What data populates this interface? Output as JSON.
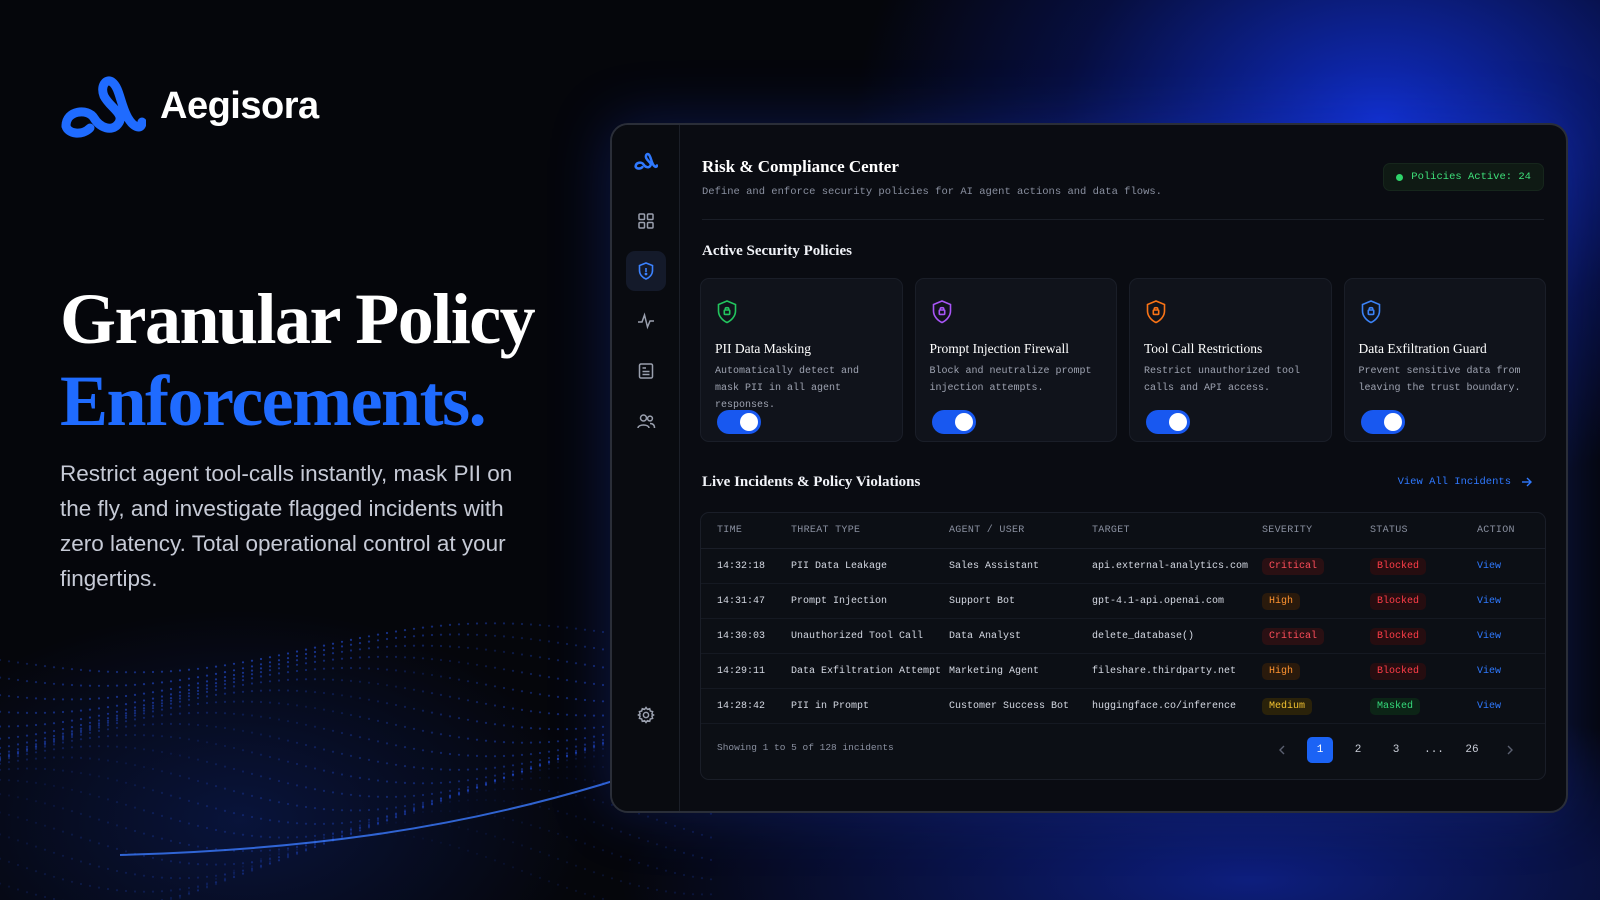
{
  "brand": {
    "name": "Aegisora"
  },
  "hero": {
    "line1": "Granular Policy",
    "line2": "Enforcements.",
    "description": "Restrict agent tool-calls instantly, mask PII on the fly, and investigate flagged incidents with zero latency. Total operational control at your fingertips."
  },
  "sidebar": {
    "items": [
      {
        "icon": "logo-icon"
      },
      {
        "icon": "dashboard-grid-icon"
      },
      {
        "icon": "shield-icon",
        "active": true
      },
      {
        "icon": "activity-icon"
      },
      {
        "icon": "report-icon"
      },
      {
        "icon": "users-icon"
      },
      {
        "icon": "gear-icon"
      }
    ]
  },
  "header": {
    "title": "Risk & Compliance Center",
    "subtitle": "Define and enforce security policies for AI agent actions and data flows.",
    "status": "Policies Active: 24"
  },
  "policies": {
    "section_title": "Active Security Policies",
    "cards": [
      {
        "title": "PII Data Masking",
        "description": "Automatically detect and mask PII in all agent responses.",
        "icon_color": "#22c55e",
        "enabled": true
      },
      {
        "title": "Prompt Injection Firewall",
        "description": "Block and neutralize prompt injection attempts.",
        "icon_color": "#a855f7",
        "enabled": true
      },
      {
        "title": "Tool Call Restrictions",
        "description": "Restrict unauthorized tool calls and API access.",
        "icon_color": "#f97316",
        "enabled": true
      },
      {
        "title": "Data Exfiltration Guard",
        "description": "Prevent sensitive data from leaving the trust boundary.",
        "icon_color": "#3b82f6",
        "enabled": true
      }
    ]
  },
  "incidents": {
    "section_title": "Live Incidents & Policy Violations",
    "view_all": "View All Incidents",
    "columns": [
      "TIME",
      "THREAT TYPE",
      "AGENT / USER",
      "TARGET",
      "SEVERITY",
      "STATUS",
      "ACTION"
    ],
    "rows": [
      {
        "time": "14:32:18",
        "threat": "PII Data Leakage",
        "agent": "Sales Assistant",
        "target": "api.external-analytics.com",
        "severity": "Critical",
        "status": "Blocked",
        "action": "View"
      },
      {
        "time": "14:31:47",
        "threat": "Prompt Injection",
        "agent": "Support Bot",
        "target": "gpt-4.1-api.openai.com",
        "severity": "High",
        "status": "Blocked",
        "action": "View"
      },
      {
        "time": "14:30:03",
        "threat": "Unauthorized Tool Call",
        "agent": "Data Analyst",
        "target": "delete_database()",
        "severity": "Critical",
        "status": "Blocked",
        "action": "View"
      },
      {
        "time": "14:29:11",
        "threat": "Data Exfiltration Attempt",
        "agent": "Marketing Agent",
        "target": "fileshare.thirdparty.net",
        "severity": "High",
        "status": "Blocked",
        "action": "View"
      },
      {
        "time": "14:28:42",
        "threat": "PII in Prompt",
        "agent": "Customer Success Bot",
        "target": "huggingface.co/inference",
        "severity": "Medium",
        "status": "Masked",
        "action": "View"
      }
    ],
    "showing": "Showing 1 to 5 of 128 incidents",
    "pagination": {
      "pages": [
        "1",
        "2",
        "3",
        "...",
        "26"
      ],
      "current": "1"
    }
  }
}
